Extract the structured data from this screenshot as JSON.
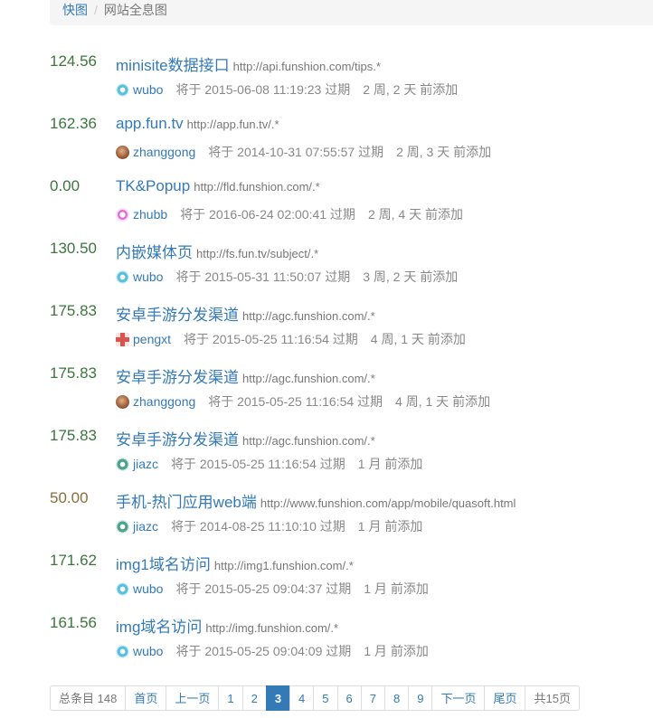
{
  "breadcrumb": {
    "home": "快图",
    "separator": "/",
    "current": "网站全息图"
  },
  "items": [
    {
      "score": "124.56",
      "title": "minisite数据接口",
      "url": "http://api.funshion.com/tips.*",
      "avatar": "avatar-cyan-icon",
      "user": "wubo",
      "expire": "将于 2015-06-08 11:19:23 过期",
      "added": "2 周, 2 天 前添加"
    },
    {
      "score": "162.36",
      "title": "app.fun.tv",
      "url": "http://app.fun.tv/.*",
      "avatar": "avatar-photo-icon",
      "user": "zhanggong",
      "expire": "将于 2014-10-31 07:55:57 过期",
      "added": "2 周, 3 天 前添加"
    },
    {
      "score": "0.00",
      "title": "TK&Popup",
      "url": "http://fld.funshion.com/.*",
      "avatar": "avatar-pink-icon",
      "user": "zhubb",
      "expire": "将于 2016-06-24 02:00:41 过期",
      "added": "2 周, 4 天 前添加"
    },
    {
      "score": "130.50",
      "title": "内嵌媒体页",
      "url": "http://fs.fun.tv/subject/.*",
      "avatar": "avatar-cyan-icon",
      "user": "wubo",
      "expire": "将于 2015-05-31 11:50:07 过期",
      "added": "3 周, 2 天 前添加"
    },
    {
      "score": "175.83",
      "title": "安卓手游分发渠道",
      "url": "http://agc.funshion.com/.*",
      "avatar": "avatar-red-icon",
      "user": "pengxt",
      "expire": "将于 2015-05-25 11:16:54 过期",
      "added": "4 周, 1 天 前添加"
    },
    {
      "score": "175.83",
      "title": "安卓手游分发渠道",
      "url": "http://agc.funshion.com/.*",
      "avatar": "avatar-photo-icon",
      "user": "zhanggong",
      "expire": "将于 2015-05-25 11:16:54 过期",
      "added": "4 周, 1 天 前添加"
    },
    {
      "score": "175.83",
      "title": "安卓手游分发渠道",
      "url": "http://agc.funshion.com/.*",
      "avatar": "avatar-green-icon",
      "user": "jiazc",
      "expire": "将于 2015-05-25 11:16:54 过期",
      "added": "1 月 前添加"
    },
    {
      "score": "50.00",
      "title": "手机-热门应用web端",
      "url": "http://www.funshion.com/app/mobile/quasoft.html",
      "avatar": "avatar-green-icon",
      "user": "jiazc",
      "expire": "将于 2014-08-25 11:10:10 过期",
      "added": "1 月 前添加"
    },
    {
      "score": "171.62",
      "title": "img1域名访问",
      "url": "http://img1.funshion.com/.*",
      "avatar": "avatar-cyan-icon",
      "user": "wubo",
      "expire": "将于 2015-05-25 09:04:37 过期",
      "added": "1 月 前添加"
    },
    {
      "score": "161.56",
      "title": "img域名访问",
      "url": "http://img.funshion.com/.*",
      "avatar": "avatar-cyan-icon",
      "user": "wubo",
      "expire": "将于 2015-05-25 09:04:09 过期",
      "added": "1 月 前添加"
    }
  ],
  "pagination": {
    "total": "总条目 148",
    "first": "首页",
    "prev": "上一页",
    "pages": [
      "1",
      "2",
      "3",
      "4",
      "5",
      "6",
      "7",
      "8",
      "9"
    ],
    "current_page": "3",
    "next": "下一页",
    "last": "尾页",
    "page_count": "共15页"
  },
  "colors": {
    "link": "#337ab7",
    "score_ok": "#3c763d",
    "score_warn": "#8a6d3b"
  }
}
